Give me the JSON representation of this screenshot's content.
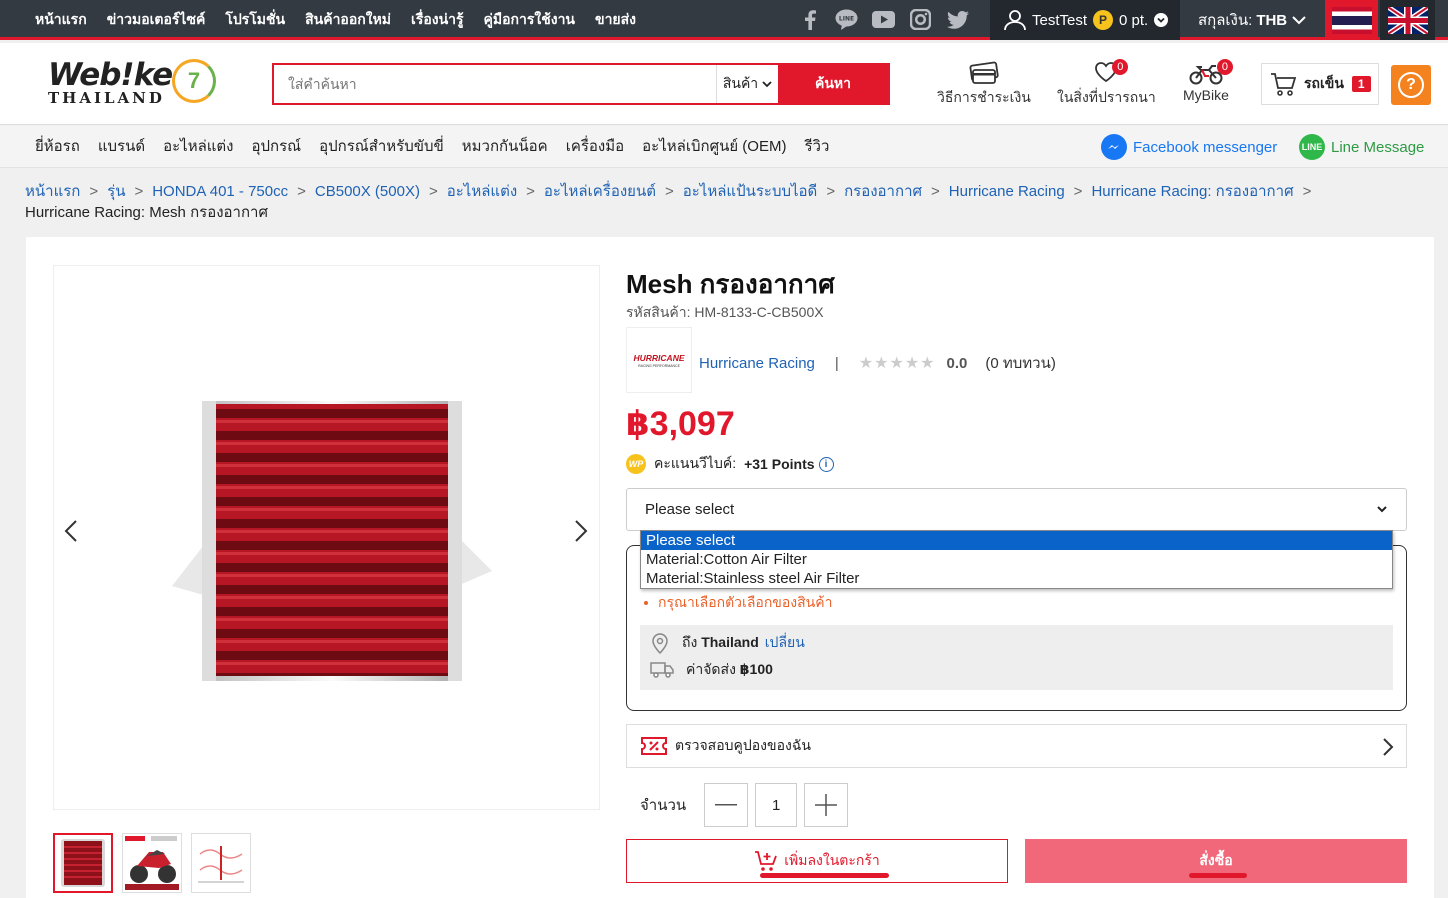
{
  "topbar": {
    "nav": [
      "หน้าแรก",
      "ข่าวมอเตอร์ไซค์",
      "โปรโมชั่น",
      "สินค้าออกใหม่",
      "เรื่องน่ารู้",
      "คู่มือการใช้งาน",
      "ขายส่ง"
    ],
    "social_icons": [
      "facebook-icon",
      "line-icon",
      "youtube-icon",
      "instagram-icon",
      "twitter-icon"
    ],
    "user_name": "TestTest",
    "coin_letter": "P",
    "points": "0 pt.",
    "currency_label": "สกุลเงิน:",
    "currency": "THB"
  },
  "header": {
    "logo_word": "Web!ke",
    "logo_sub": "THAILAND",
    "anniv": "7",
    "search_placeholder": "ใส่คำค้นหา",
    "search_category": "สินค้า",
    "search_button": "ค้นหา",
    "payment_label": "วิธีการชำระเงิน",
    "wishlist_label": "ในสิ่งที่ปรารถนา",
    "wishlist_count": "0",
    "mybike_label": "MyBike",
    "mybike_count": "0",
    "cart_label": "รถเข็น",
    "cart_count": "1",
    "help_symbol": "?"
  },
  "catnav": {
    "items": [
      "ยี่ห้อรถ",
      "แบรนด์",
      "อะไหล่แต่ง",
      "อุปกรณ์",
      "อุปกรณ์สำหรับขับขี่",
      "หมวกกันน็อค",
      "เครื่องมือ",
      "อะไหล่เบิกศูนย์ (OEM)",
      "รีวิว"
    ],
    "facebook": "Facebook messenger",
    "line": "Line Message",
    "line_icon_text": "LINE"
  },
  "breadcrumb": {
    "items": [
      "หน้าแรก",
      "รุ่น",
      "HONDA 401 - 750cc",
      "CB500X (500X)",
      "อะไหล่แต่ง",
      "อะไหล่เครื่องยนต์",
      "อะไหล่แป้นระบบไอดี",
      "กรองอากาศ",
      "Hurricane Racing",
      "Hurricane Racing: กรองอากาศ"
    ],
    "current": "Hurricane Racing: Mesh กรองอากาศ"
  },
  "product": {
    "title": "Mesh กรองอากาศ",
    "sku_label": "รหัสสินค้า:",
    "sku": "HM-8133-C-CB500X",
    "brand_logo_text": "HURRICANE",
    "brand_logo_sub": "RACING PERFORMANCE",
    "brand": "Hurricane Racing",
    "divider": "|",
    "rating": "0.0",
    "reviews": "(0 ทบทวน)",
    "price": "฿3,097",
    "points_badge": "WP",
    "points_label": "คะแนนวีไบค์:",
    "points_value": "+31 Points",
    "info_symbol": "i",
    "select_value": "Please select",
    "options": [
      "Please select",
      "Material:Cotton Air Filter",
      "Material:Stainless steel Air Filter"
    ],
    "error": "กรุณาเลือกตัวเลือกของสินค้า",
    "ship_to_label": "ถึง",
    "ship_to": "Thailand",
    "ship_change": "เปลี่ยน",
    "ship_fee_label": "ค่าจัดส่ง",
    "ship_fee": "฿100",
    "coupon": "ตรวจสอบคูปองของฉัน",
    "qty_label": "จำนวน",
    "qty": "1",
    "add_to_cart": "เพิ่มลงในตะกร้า",
    "buy": "สั่งซื้อ"
  },
  "colors": {
    "accent": "#e1182c",
    "link": "#1f62b4",
    "topbar": "#333a42",
    "buy_button": "#f0687a"
  }
}
